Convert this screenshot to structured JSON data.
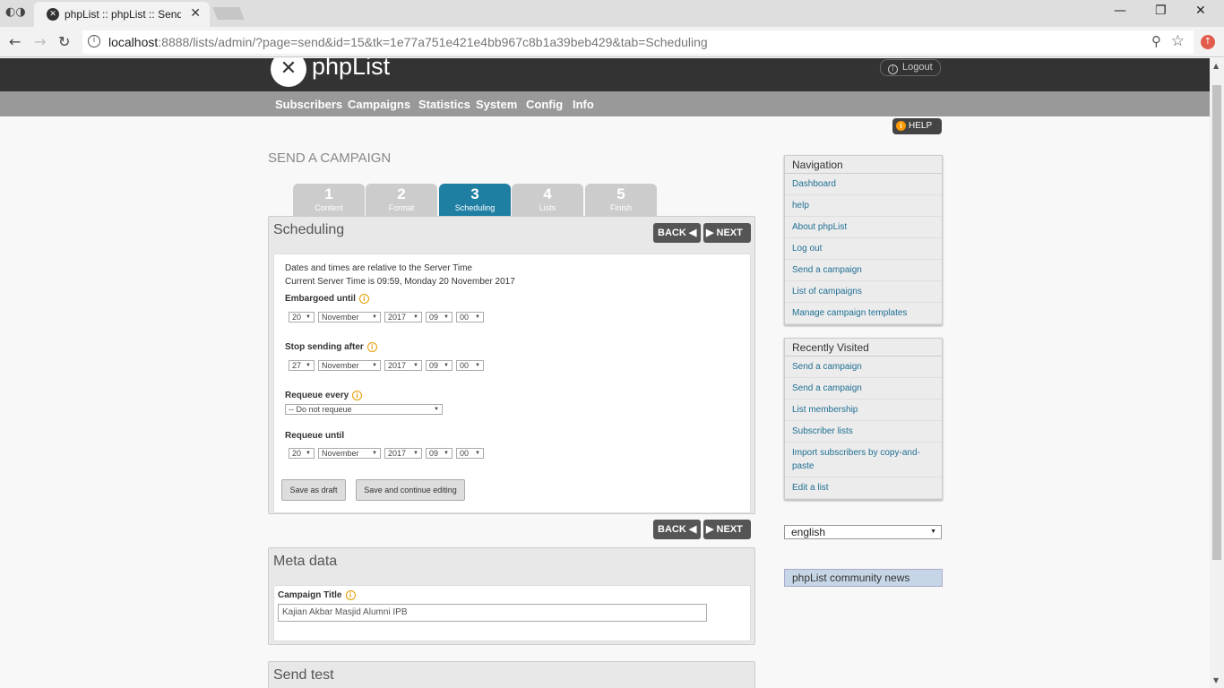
{
  "browser": {
    "tab_title": "phpList :: phpList :: Send",
    "url_host": "localhost",
    "url_rest": ":8888/lists/admin/?page=send&id=15&tk=1e77a751e421e4bb967c8b1a39beb429&tab=Scheduling"
  },
  "header": {
    "logo_text": "phpList",
    "logout_label": "Logout"
  },
  "menu": [
    "Subscribers",
    "Campaigns",
    "Statistics",
    "System",
    "Config",
    "Info"
  ],
  "help_label": "HELP",
  "page_title": "SEND A CAMPAIGN",
  "steps": [
    {
      "num": "1",
      "label": "Content"
    },
    {
      "num": "2",
      "label": "Format"
    },
    {
      "num": "3",
      "label": "Scheduling"
    },
    {
      "num": "4",
      "label": "Lists"
    },
    {
      "num": "5",
      "label": "Finish"
    }
  ],
  "scheduling": {
    "title": "Scheduling",
    "back_label": "BACK",
    "next_label": "NEXT",
    "line1": "Dates and times are relative to the Server Time",
    "line2": "Current Server Time is 09:59, Monday 20 November 2017",
    "embargo_label": "Embargoed until",
    "embargo": {
      "day": "20",
      "month": "November",
      "year": "2017",
      "hour": "09",
      "min": "00"
    },
    "stop_label": "Stop sending after",
    "stop": {
      "day": "27",
      "month": "November",
      "year": "2017",
      "hour": "09",
      "min": "00"
    },
    "requeue_label": "Requeue every",
    "requeue_value": "-- Do not requeue",
    "requeue_until_label": "Requeue until",
    "requeue_until": {
      "day": "20",
      "month": "November",
      "year": "2017",
      "hour": "09",
      "min": "00"
    },
    "save_draft": "Save as draft",
    "save_continue": "Save and continue editing"
  },
  "meta": {
    "title": "Meta data",
    "campaign_title_label": "Campaign Title",
    "campaign_title_value": "Kajian Akbar Masjid Alumni IPB"
  },
  "send_test": {
    "title": "Send test"
  },
  "navigation": {
    "title": "Navigation",
    "items": [
      "Dashboard",
      "help",
      "About phpList",
      "Log out",
      "Send a campaign",
      "List of campaigns",
      "Manage campaign templates"
    ]
  },
  "recent": {
    "title": "Recently Visited",
    "items": [
      "Send a campaign",
      "Send a campaign",
      "List membership",
      "Subscriber lists",
      "Import subscribers by copy-and-paste",
      "Edit a list"
    ]
  },
  "language": "english",
  "news_title": "phpList community news"
}
